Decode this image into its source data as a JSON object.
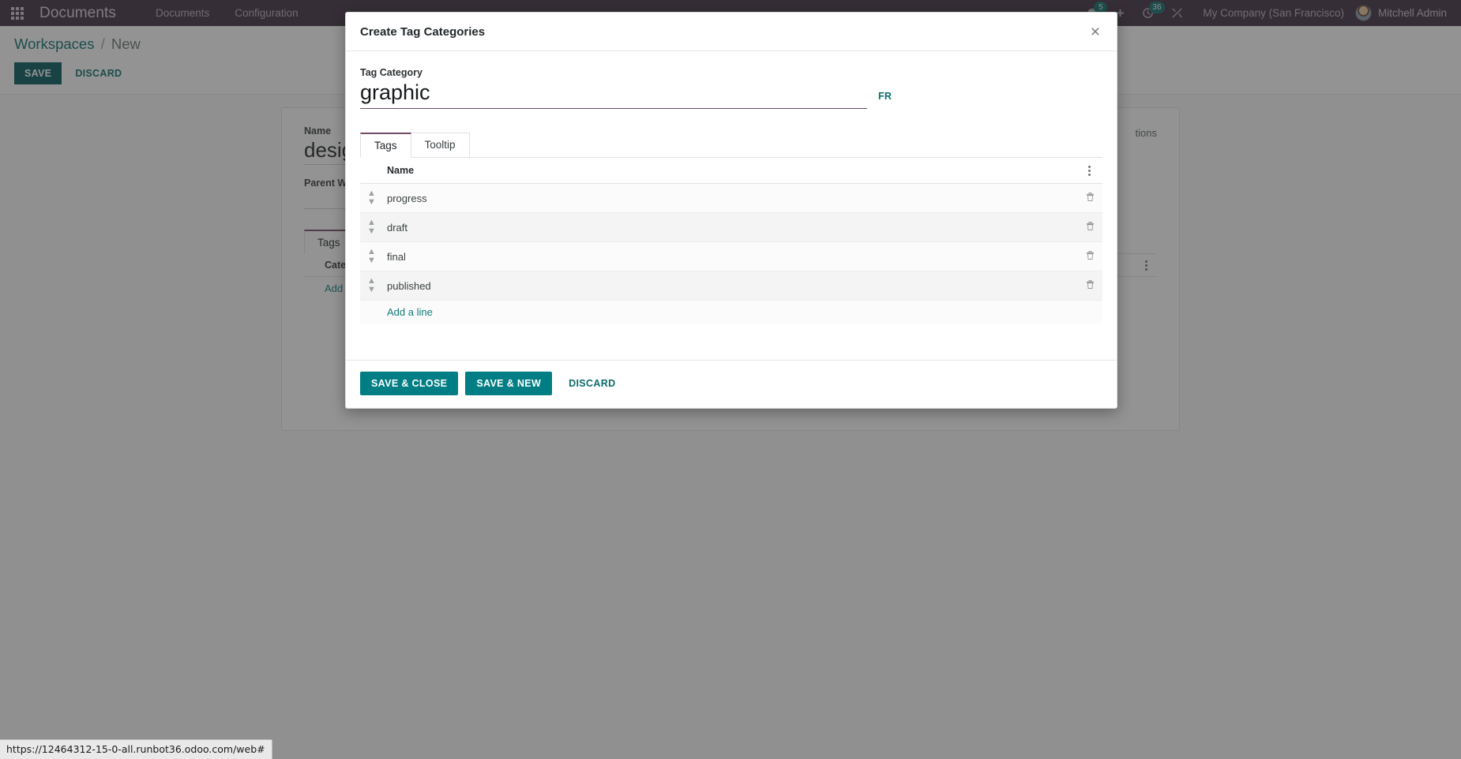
{
  "navbar": {
    "apps_icon": "apps-grid-icon",
    "brand": "Documents",
    "menu_items": [
      {
        "label": "Documents"
      },
      {
        "label": "Configuration"
      }
    ],
    "messages_badge": "5",
    "activities_badge": "36",
    "company": "My Company (San Francisco)",
    "user": "Mitchell Admin",
    "icons": {
      "messages": "chat-bubble-icon",
      "plus": "plus-icon",
      "activities": "clock-icon",
      "debug": "wrench-icon"
    }
  },
  "background": {
    "breadcrumb": {
      "root": "Workspaces",
      "separator": "/",
      "current": "New"
    },
    "buttons": {
      "save": "SAVE",
      "discard": "DISCARD"
    },
    "sheet": {
      "top_right_label": "tions",
      "name_label": "Name",
      "name_value": "desig",
      "parent_label": "Parent Wor",
      "tabs": [
        {
          "label": "Tags",
          "active": true
        }
      ],
      "table_header": "Categor",
      "add_line": "Add a li"
    }
  },
  "dialog": {
    "title": "Create Tag Categories",
    "close_icon": "close-icon",
    "tag_category_label": "Tag Category",
    "tag_category_value": "graphic",
    "tag_category_placeholder": "",
    "language_link": "FR",
    "tabs": [
      {
        "label": "Tags",
        "active": true
      },
      {
        "label": "Tooltip",
        "active": false
      }
    ],
    "table": {
      "columns": [
        "Name"
      ],
      "options_icon": "kebab-menu-icon",
      "rows": [
        {
          "name": "progress",
          "handle_icon": "drag-handle-icon",
          "delete_icon": "trash-icon"
        },
        {
          "name": "draft",
          "handle_icon": "drag-handle-icon",
          "delete_icon": "trash-icon"
        },
        {
          "name": "final",
          "handle_icon": "drag-handle-icon",
          "delete_icon": "trash-icon"
        },
        {
          "name": "published",
          "handle_icon": "drag-handle-icon",
          "delete_icon": "trash-icon"
        }
      ],
      "add_line": "Add a line"
    },
    "footer": {
      "save_close": "SAVE & CLOSE",
      "save_new": "SAVE & NEW",
      "discard": "DISCARD"
    }
  },
  "statusbar": {
    "url": "https://12464312-15-0-all.runbot36.odoo.com/web#"
  },
  "colors": {
    "navbar_bg": "#3b2c3e",
    "accent_primary": "#017e84",
    "accent_link": "#0d6b6b",
    "tab_active_border": "#714b67",
    "badge_bg": "#0e6b6b"
  }
}
